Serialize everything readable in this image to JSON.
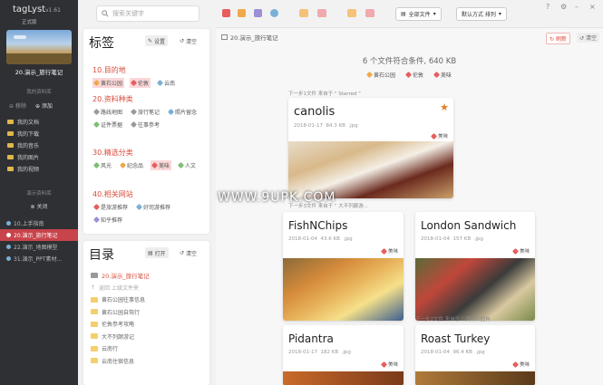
{
  "app": {
    "name": "tagLyst",
    "version": "v1.61",
    "edition": "正式版"
  },
  "sidebar": {
    "current_project": "20.演示_旅行笔记",
    "library_label": "我的资料库",
    "lib_actions": {
      "disabled": "移除",
      "add": "添加"
    },
    "folders": [
      "我的文档",
      "我的下载",
      "我的音乐",
      "我的图片",
      "我的视频"
    ],
    "projects_label": "演示资料库",
    "close_label": "关闭",
    "projects": [
      "10.上手指南",
      "20.演示_旅行笔记",
      "22.演示_地图模型",
      "31.演示_PPT素材..."
    ]
  },
  "toolbar": {
    "search_placeholder": "搜索关键字",
    "all_files": "全部文件",
    "sort": "默认方式 排列",
    "colors": {
      "c1": "#e85d5d",
      "c2": "#f0a94a",
      "c3": "#7ab0d6",
      "c4": "#9b8fd6",
      "c5": "#e8e8e8"
    }
  },
  "tags_panel": {
    "title": "标签",
    "settings": "设置",
    "clear": "清空",
    "groups": [
      {
        "title": "10.目的地",
        "tags": [
          {
            "label": "黄石公园",
            "color": "#f0a94a",
            "selected": true
          },
          {
            "label": "伦敦",
            "color": "#e85d5d",
            "selected": true
          },
          {
            "label": "云南",
            "color": "#7ab0d6",
            "selected": false
          }
        ]
      },
      {
        "title": "20.资料种类",
        "tags": [
          {
            "label": "路线地图",
            "color": "#9a9a9a",
            "selected": false
          },
          {
            "label": "旅行笔记",
            "color": "#9a9a9a",
            "selected": false
          },
          {
            "label": "照片留念",
            "color": "#7ab0d6",
            "selected": false
          },
          {
            "label": "证件票据",
            "color": "#7dbf74",
            "selected": false
          },
          {
            "label": "往事参考",
            "color": "#9a9a9a",
            "selected": false
          }
        ]
      },
      {
        "title": "30.精选分类",
        "tags": [
          {
            "label": "风光",
            "color": "#7dbf74",
            "selected": false
          },
          {
            "label": "纪念品",
            "color": "#f0a94a",
            "selected": false
          },
          {
            "label": "美味",
            "color": "#e85d5d",
            "selected": true
          },
          {
            "label": "人文",
            "color": "#7dbf74",
            "selected": false
          }
        ]
      },
      {
        "title": "40.相关网站",
        "tags": [
          {
            "label": "是旅游推荐",
            "color": "#e85d5d",
            "selected": false
          },
          {
            "label": "好司游推荐",
            "color": "#7ab0d6",
            "selected": false
          },
          {
            "label": "知乎推荐",
            "color": "#9b8fd6",
            "selected": false
          }
        ]
      }
    ]
  },
  "dir_panel": {
    "title": "目录",
    "open": "打开",
    "clear": "清空",
    "current": "20.演示_旅行笔记",
    "up": "返回 上级文件夹",
    "folders": [
      "黄石公园往事信息",
      "黄石公园自驾行",
      "伦敦参考攻略",
      "大不列颠游记",
      "云南行",
      "云南住宿信息"
    ]
  },
  "main": {
    "path": "20.演示_旅行笔记",
    "refresh": "刷新",
    "clear": "清空",
    "summary": "6 个文件符合条件, 640 KB",
    "summary_tags": [
      {
        "label": "黄石公园",
        "color": "#f0a94a"
      },
      {
        "label": "伦敦",
        "color": "#e85d5d"
      },
      {
        "label": "美味",
        "color": "#e85d5d"
      }
    ],
    "hints": {
      "h1": "下一步1文件 来自于 \" Starred \"",
      "h2": "下一步3文件 来自于 \" 大不列颠游...",
      "h3": "下一步2文件 来自于 \" 黄石公园自..."
    },
    "cards": [
      {
        "title": "canolis",
        "date": "2018-01-17",
        "size": "84.3 KB",
        "ext": ".jpg",
        "tag": "美味"
      },
      {
        "title": "FishNChips",
        "date": "2018-01-04",
        "size": "43.6 KB",
        "ext": ".jpg",
        "tag": "美味"
      },
      {
        "title": "London Sandwich",
        "date": "2018-01-04",
        "size": "157 KB",
        "ext": ".jpg",
        "tag": "美味"
      },
      {
        "title": "Pidantra",
        "date": "2018-01-17",
        "size": "182 KB",
        "ext": ".jpg",
        "tag": "美味"
      },
      {
        "title": "Roast Turkey",
        "date": "2018-01-04",
        "size": "96.4 KB",
        "ext": ".jpg",
        "tag": "美味"
      }
    ],
    "watermark": "WWW.9UPK.COM"
  }
}
